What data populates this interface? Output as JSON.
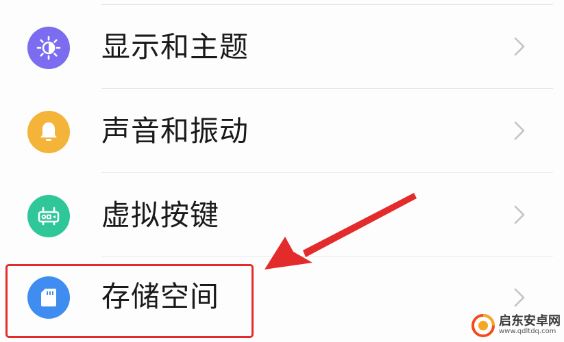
{
  "settings_items": [
    {
      "label": "显示和主题",
      "icon": "display-theme-icon",
      "color": "#7b6cf0"
    },
    {
      "label": "声音和振动",
      "icon": "bell-icon",
      "color": "#f4b43a"
    },
    {
      "label": "虚拟按键",
      "icon": "virtual-keys-icon",
      "color": "#2fc79a"
    },
    {
      "label": "存储空间",
      "icon": "sd-card-icon",
      "color": "#3f8df1"
    }
  ],
  "annotation": {
    "highlight_color": "#e42b2b",
    "highlight_target": "存储空间"
  },
  "watermark": {
    "title": "启东安卓网",
    "url": "www.qdltdq.com",
    "logo_color": "#f24c1c"
  }
}
